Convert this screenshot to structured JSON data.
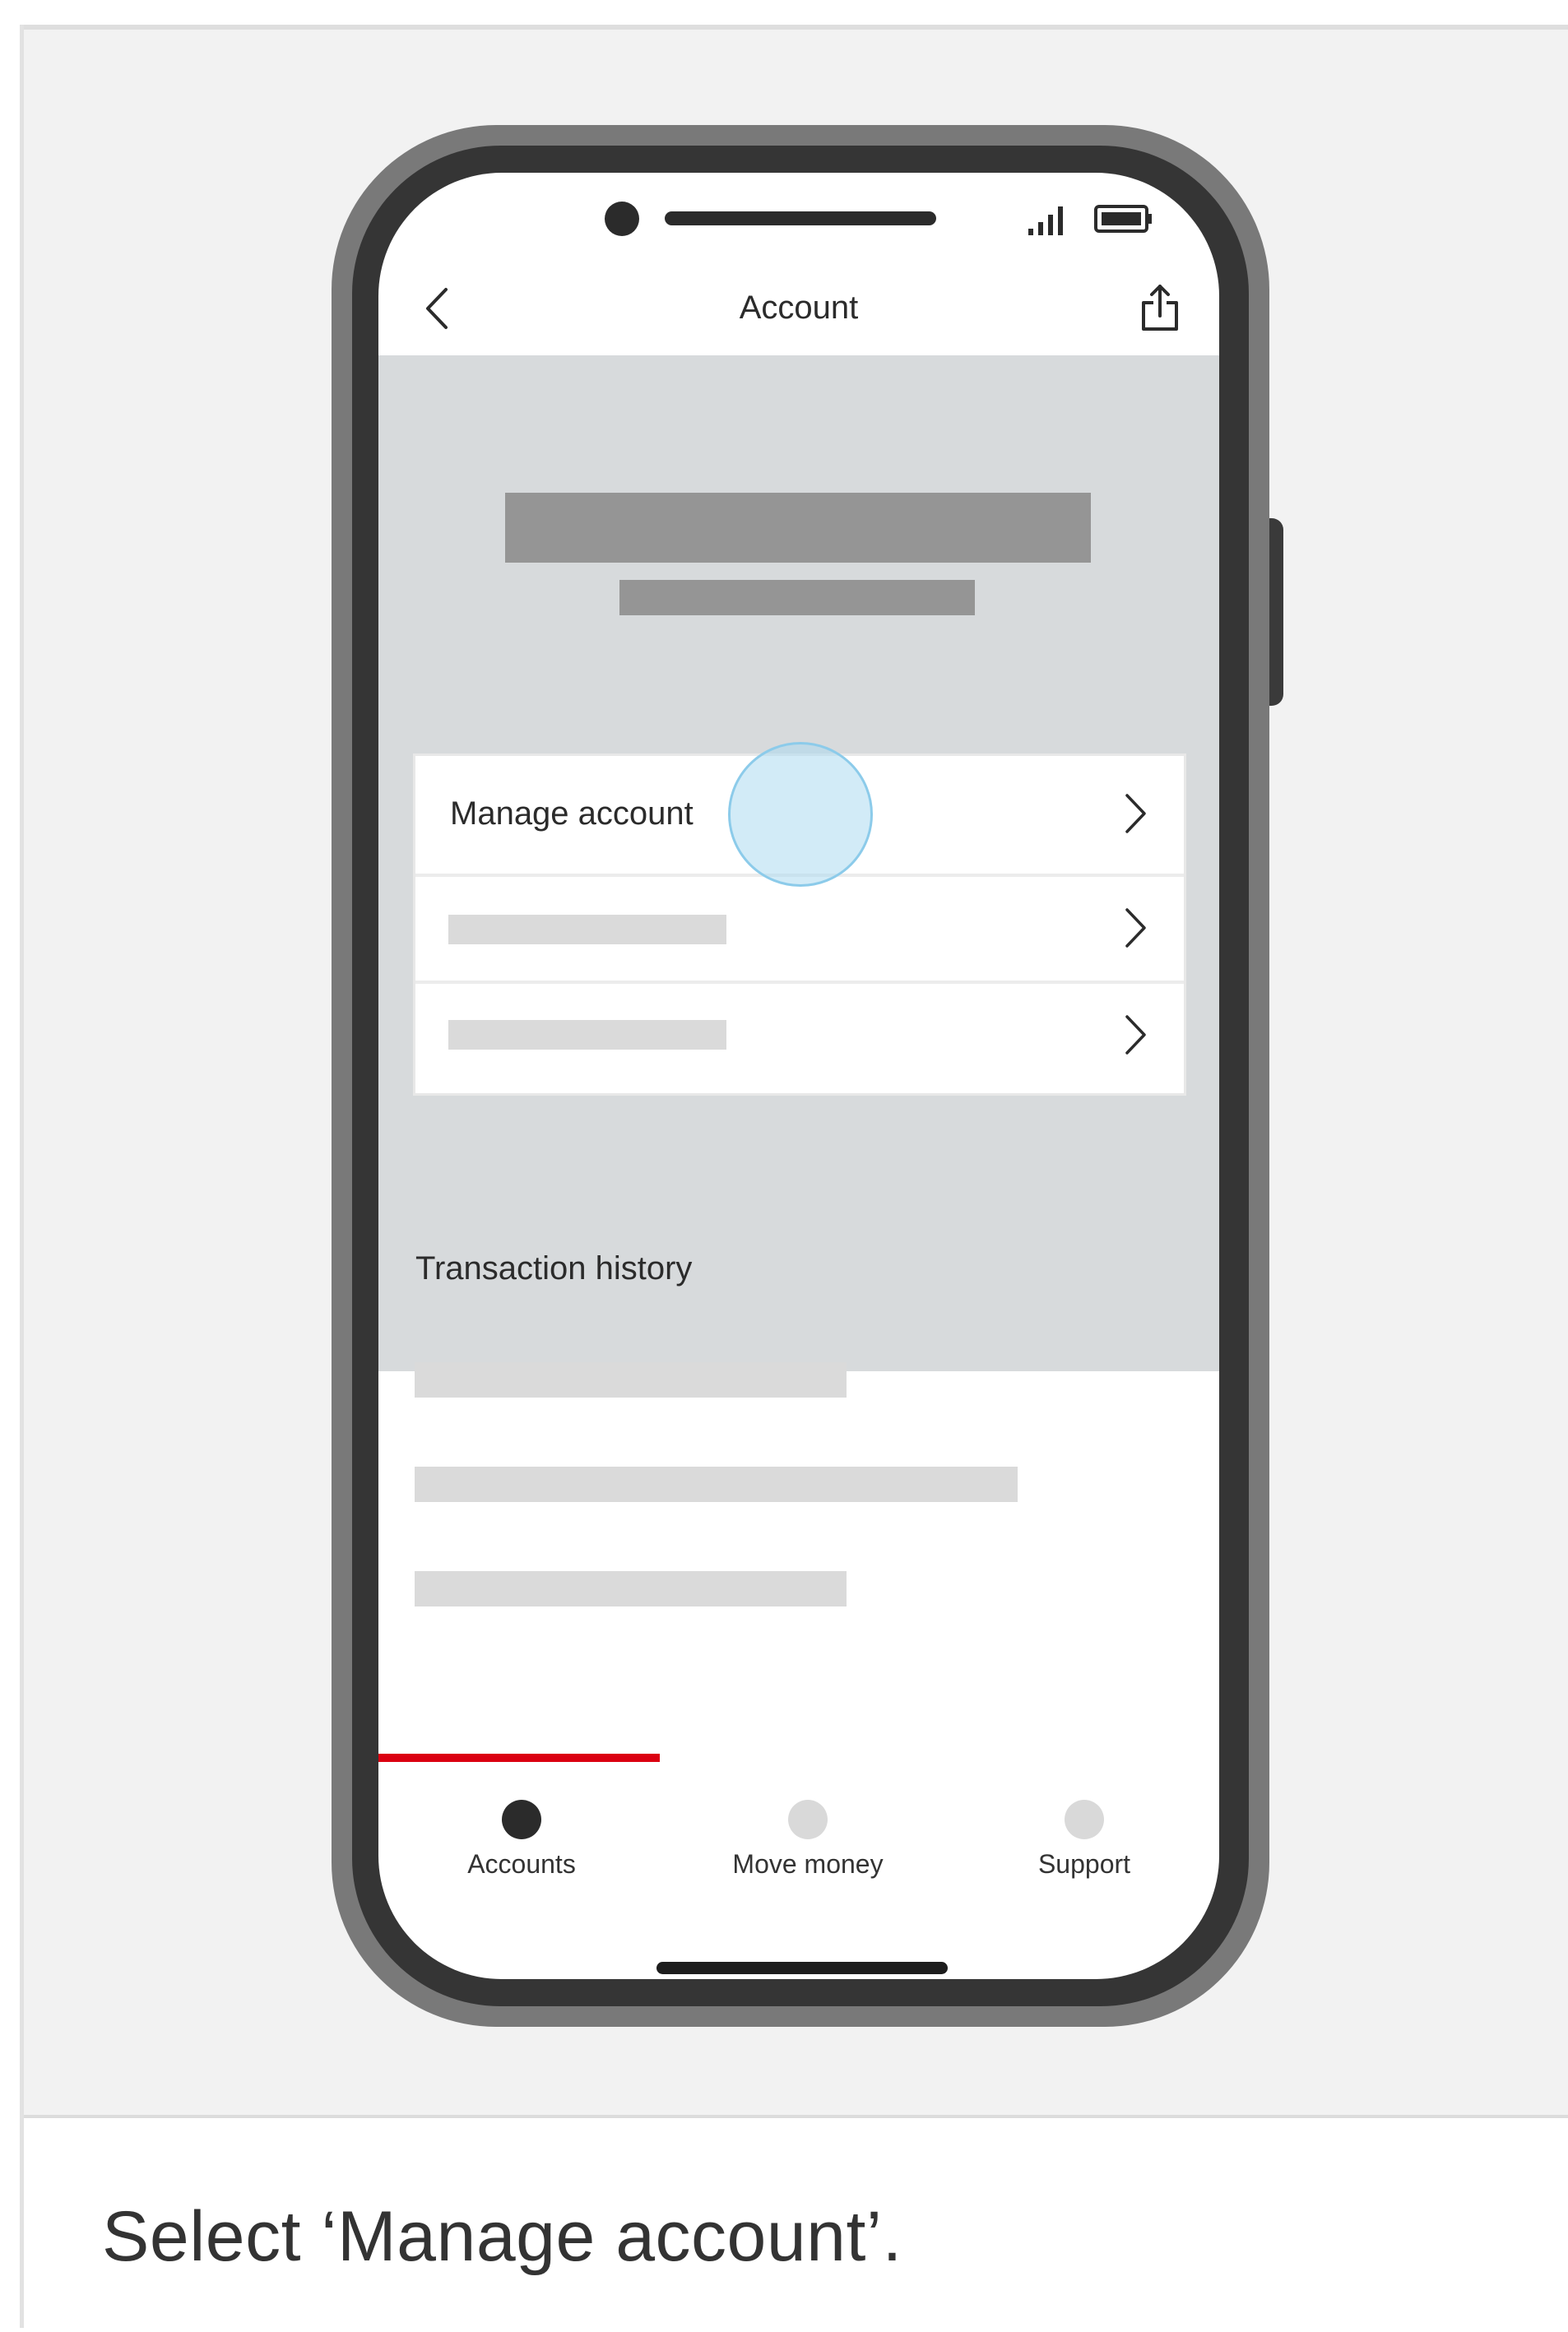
{
  "caption": "Select ‘Manage account’.",
  "phone": {
    "nav": {
      "title": "Account",
      "back_icon": "chevron-left-icon",
      "share_icon": "share-icon"
    },
    "status_bar": {
      "signal_icon": "signal-bars-icon",
      "battery_icon": "battery-icon"
    },
    "options": [
      {
        "label": "Manage account",
        "chevron_icon": "chevron-right-icon"
      },
      {
        "label": "",
        "chevron_icon": "chevron-right-icon"
      },
      {
        "label": "",
        "chevron_icon": "chevron-right-icon"
      }
    ],
    "transaction_history": {
      "title": "Transaction history"
    },
    "tabs": [
      {
        "label": "Accounts",
        "active": true
      },
      {
        "label": "Move money",
        "active": false
      },
      {
        "label": "Support",
        "active": false
      }
    ]
  },
  "colors": {
    "accent": "#db0011",
    "header_background": "#d7dadc",
    "placeholder_dark": "#959595",
    "placeholder_light": "#dadada",
    "tab_active": "#2b2b2b",
    "tab_inactive": "#d9d9d9",
    "tap_indicator": "#8ccbea"
  }
}
